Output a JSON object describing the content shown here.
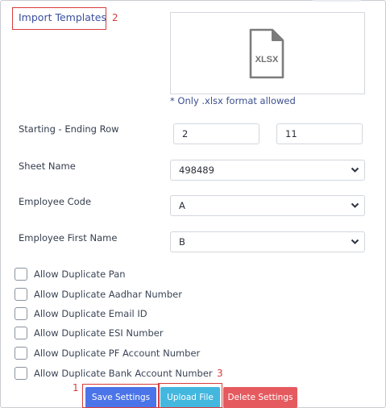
{
  "import_templates": {
    "title": "Import Templates",
    "upload_icon_label": "XLSX",
    "format_note": "* Only .xlsx format allowed"
  },
  "annotations": [
    "1",
    "2",
    "3"
  ],
  "form": {
    "row_range": {
      "label": "Starting - Ending Row",
      "start": "2",
      "end": "11"
    },
    "sheet_name": {
      "label": "Sheet Name",
      "value": "498489"
    },
    "employee_code": {
      "label": "Employee Code",
      "value": "A"
    },
    "employee_first_name": {
      "label": "Employee First Name",
      "value": "B"
    }
  },
  "checkboxes": [
    {
      "label": "Allow Duplicate Pan",
      "checked": false
    },
    {
      "label": "Allow Duplicate Aadhar Number",
      "checked": false
    },
    {
      "label": "Allow Duplicate Email ID",
      "checked": false
    },
    {
      "label": "Allow Duplicate ESI Number",
      "checked": false
    },
    {
      "label": "Allow Duplicate PF Account Number",
      "checked": false
    },
    {
      "label": "Allow Duplicate Bank Account Number",
      "checked": false
    }
  ],
  "buttons": {
    "save": "Save Settings",
    "upload": "Upload File",
    "delete": "Delete Settings"
  },
  "colors": {
    "save": "#4b74e8",
    "upload": "#44b7df",
    "delete": "#e55a5f",
    "annotation": "#d93c3c"
  }
}
